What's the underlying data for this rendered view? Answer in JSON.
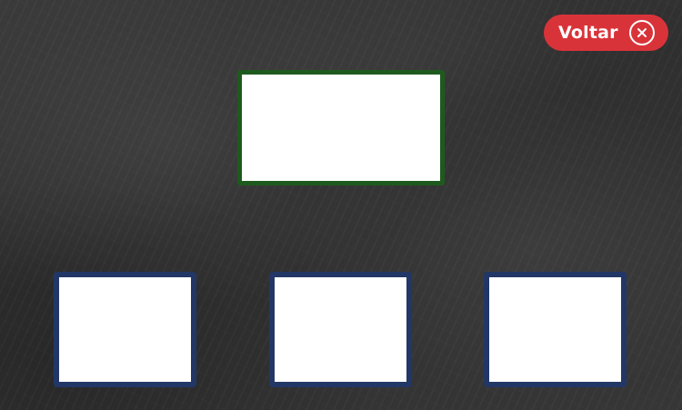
{
  "header": {
    "back_button_label": "Voltar",
    "back_button_icon": "close-icon"
  },
  "colors": {
    "board": "#333333",
    "back_button": "#d9333a",
    "top_slot_border": "#1e5a1e",
    "bottom_slot_border": "#223766",
    "slot_fill": "#ffffff"
  },
  "slots": {
    "top": {
      "content": ""
    },
    "bottom": [
      {
        "content": ""
      },
      {
        "content": ""
      },
      {
        "content": ""
      }
    ]
  }
}
